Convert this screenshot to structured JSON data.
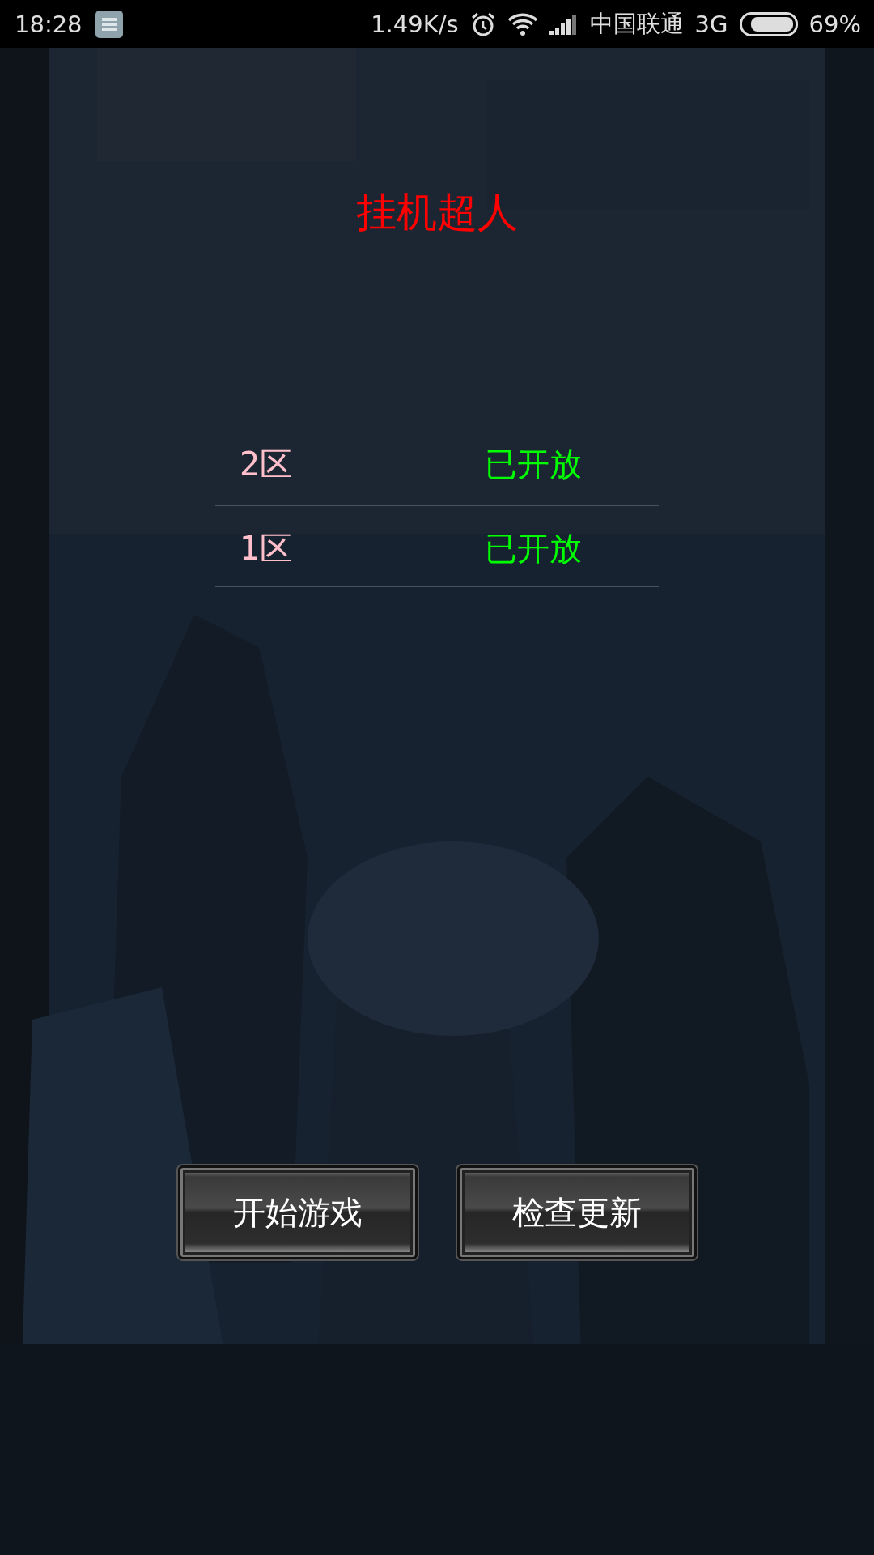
{
  "status_bar": {
    "time": "18:28",
    "speed": "1.49K/s",
    "carrier": "中国联通",
    "network": "3G",
    "battery": "69%"
  },
  "title": "挂机超人",
  "servers": [
    {
      "name": "2区",
      "status": "已开放"
    },
    {
      "name": "1区",
      "status": "已开放"
    }
  ],
  "buttons": [
    "开始游戏",
    "检查更新"
  ]
}
